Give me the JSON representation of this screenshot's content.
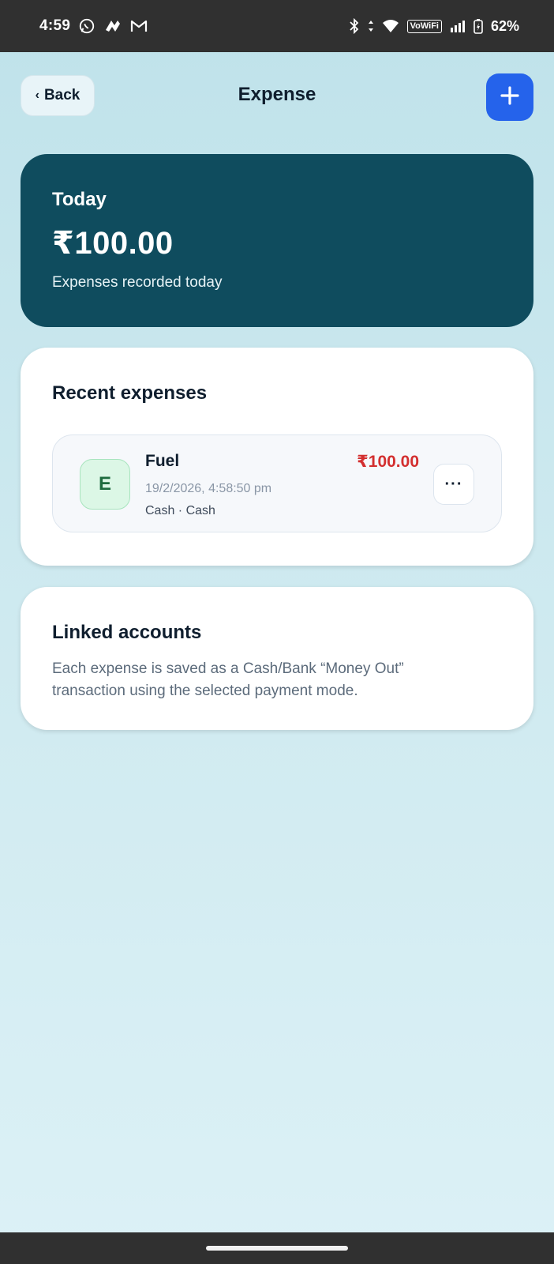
{
  "status_bar": {
    "time": "4:59",
    "vowifi": "VoWiFi",
    "battery_pct": "62%",
    "icons": [
      "whatsapp-icon",
      "app-icon",
      "gmail-icon",
      "bluetooth-icon",
      "data-arrows-icon",
      "wifi-icon",
      "signal-icon",
      "battery-charging-icon"
    ]
  },
  "header": {
    "back_label": "Back",
    "title": "Expense",
    "add_icon": "plus-icon"
  },
  "today_card": {
    "label": "Today",
    "amount": "₹100.00",
    "subtitle": "Expenses recorded today"
  },
  "recent": {
    "title": "Recent expenses",
    "items": [
      {
        "avatar_letter": "E",
        "name": "Fuel",
        "date": "19/2/2026, 4:58:50 pm",
        "mode": "Cash · Cash",
        "amount": "₹100.00",
        "more_label": "···"
      }
    ]
  },
  "linked": {
    "title": "Linked accounts",
    "text": "Each expense is saved as a Cash/Bank “Money Out” transaction using the selected payment mode."
  },
  "colors": {
    "accent": "#2563eb",
    "today_card": "#0f4c5e",
    "amount_negative": "#d32f2f",
    "avatar_bg": "#dcf7e6"
  }
}
